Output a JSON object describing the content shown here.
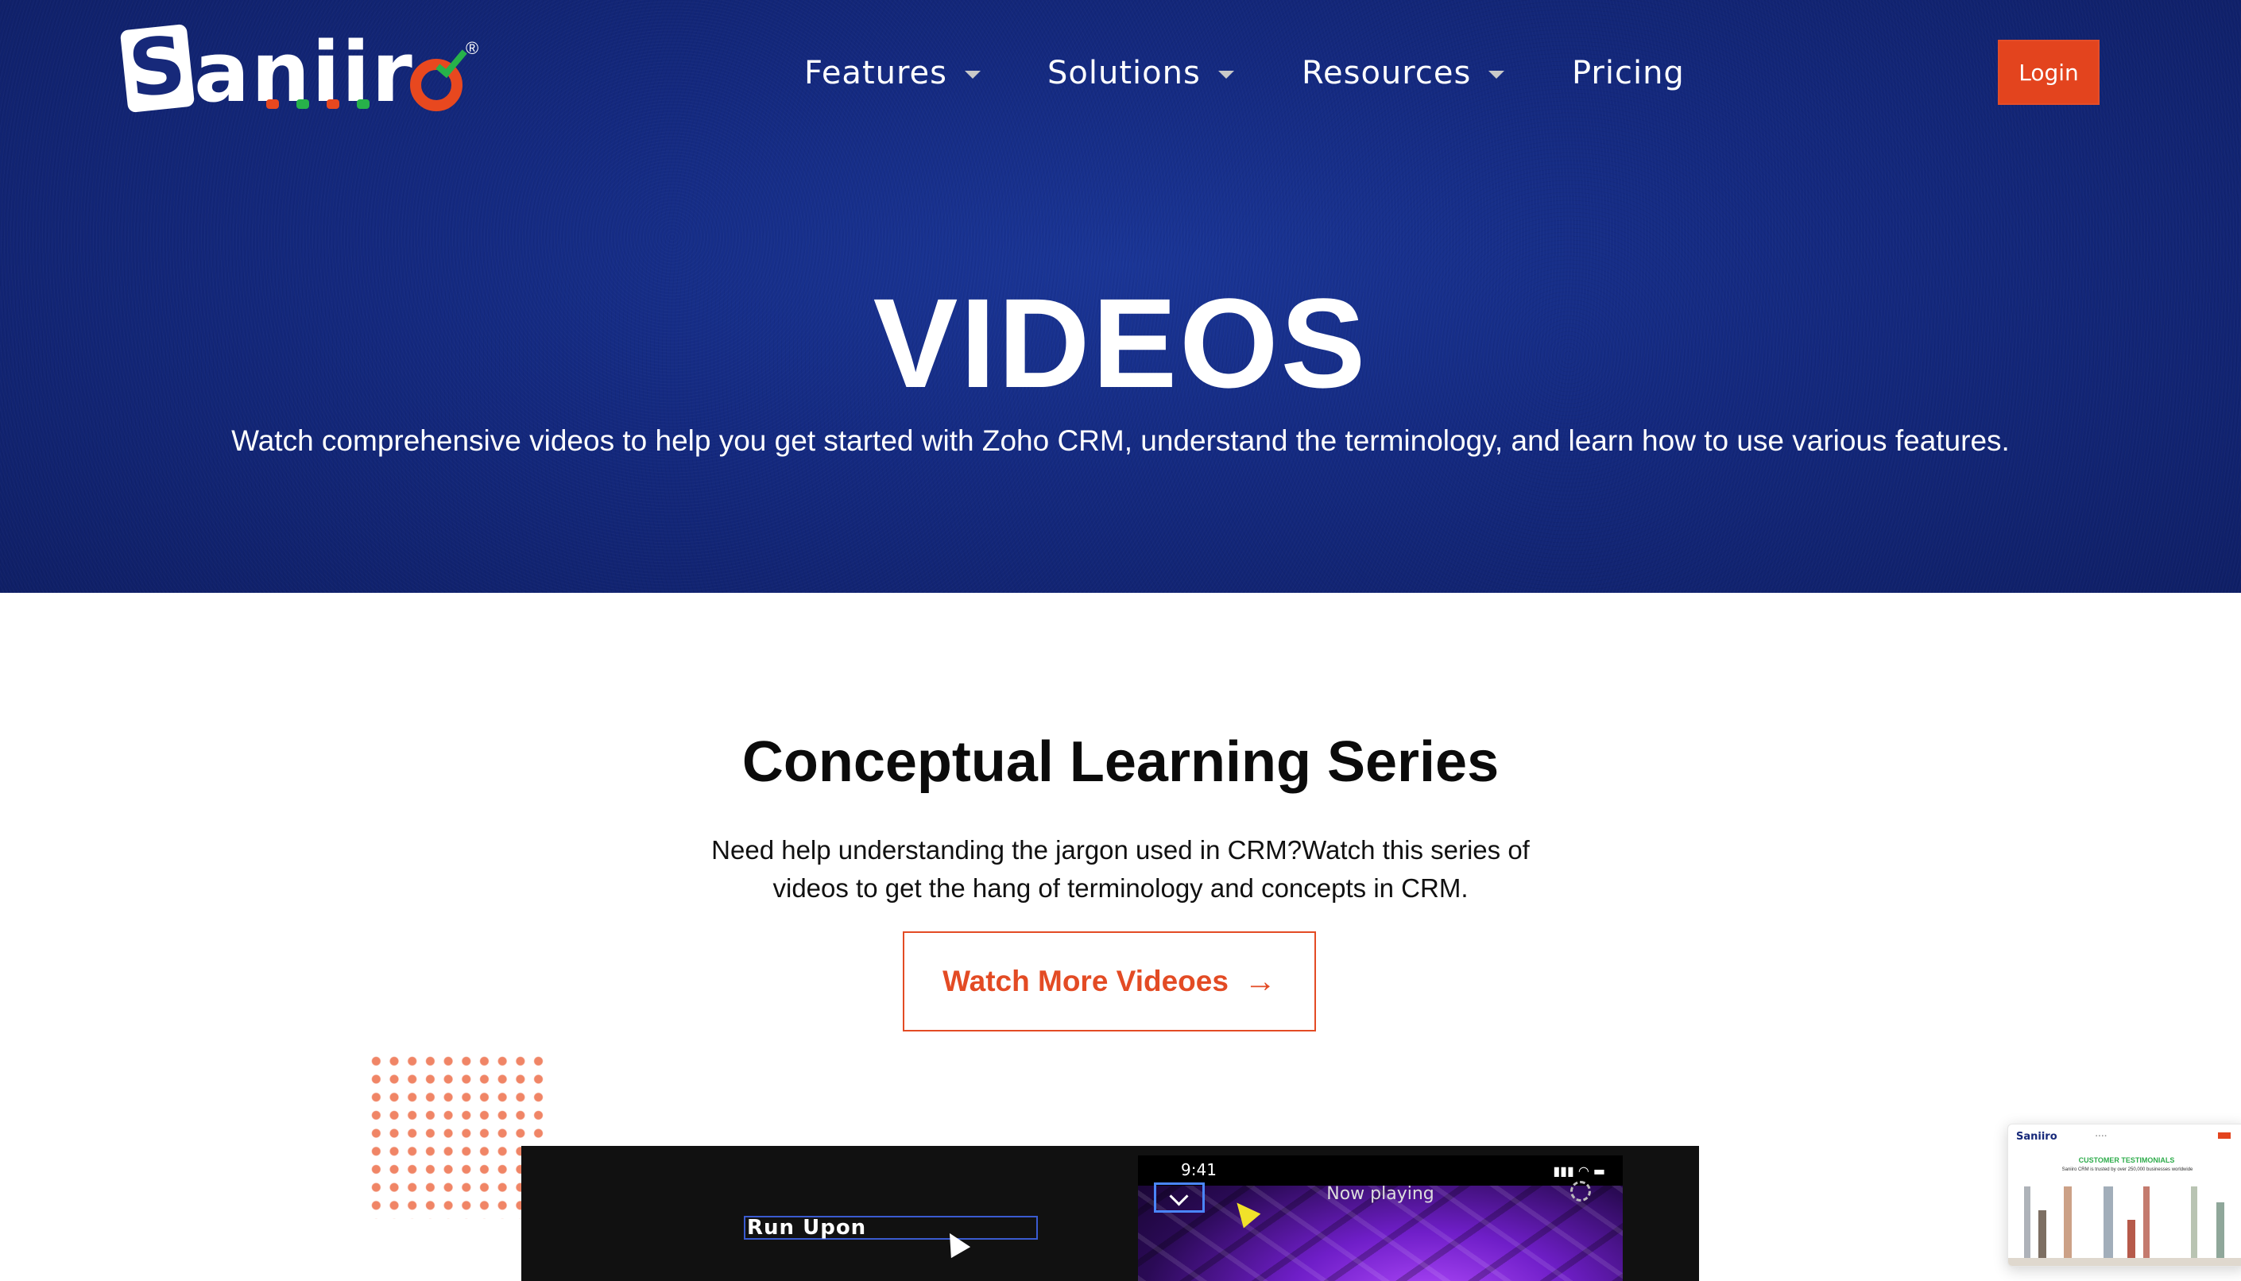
{
  "brand": {
    "name": "Saniiro",
    "logo_first_letter": "S",
    "logo_rest": "aniir",
    "registered": "®",
    "colors": {
      "primary_blue": "#14297f",
      "accent_orange": "#e3441e",
      "green": "#27b24a"
    }
  },
  "nav": {
    "items": [
      {
        "label": "Features",
        "dropdown": true
      },
      {
        "label": "Solutions",
        "dropdown": true
      },
      {
        "label": "Resources",
        "dropdown": true
      },
      {
        "label": "Pricing",
        "dropdown": false
      }
    ],
    "login_label": "Login"
  },
  "hero": {
    "title": "VIDEOS",
    "subtitle": "Watch comprehensive videos to help you get started with Zoho CRM, understand the terminology, and learn how to use various features."
  },
  "section": {
    "title": "Conceptual Learning Series",
    "description": "Need help understanding the jargon used in CRM?Watch this series of videos to get the hang of terminology and concepts in CRM.",
    "cta_label": "Watch More Videoes",
    "cta_icon": "arrow-right-icon"
  },
  "video": {
    "input_text": "Run Upon",
    "phone_time": "9:41",
    "phone_title": "Now playing"
  },
  "mini_preview": {
    "logo": "Saniiro",
    "heading": "CUSTOMER TESTIMONIALS",
    "text": "Saniiro CRM is trusted by over 250,000 businesses worldwide"
  }
}
